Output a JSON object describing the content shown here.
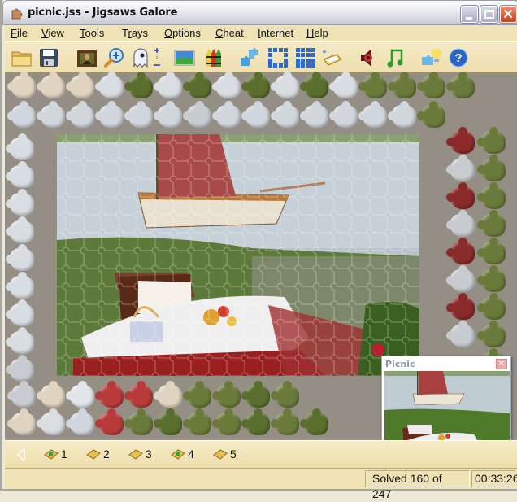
{
  "window": {
    "title": "picnic.jss - Jigsaws Galore",
    "controls": [
      "minimize",
      "maximize",
      "close"
    ]
  },
  "menu": [
    {
      "label": "File",
      "accel": "F"
    },
    {
      "label": "View",
      "accel": "V"
    },
    {
      "label": "Tools",
      "accel": "T"
    },
    {
      "label": "Trays",
      "accel": "r"
    },
    {
      "label": "Options",
      "accel": "O"
    },
    {
      "label": "Cheat",
      "accel": "C"
    },
    {
      "label": "Internet",
      "accel": "I"
    },
    {
      "label": "Help",
      "accel": "H"
    }
  ],
  "toolbar": [
    {
      "name": "open",
      "icon": "folder-icon"
    },
    {
      "name": "save",
      "icon": "floppy-disk-icon"
    },
    {
      "name": "picture",
      "icon": "mona-lisa-icon"
    },
    {
      "name": "zoom",
      "icon": "magnifier-icon"
    },
    {
      "name": "ghost",
      "icon": "ghost-icon"
    },
    {
      "name": "ghost-adjust",
      "icon": "plus-minus-icon"
    },
    {
      "name": "background",
      "icon": "landscape-icon"
    },
    {
      "name": "colors",
      "icon": "crayons-icon"
    },
    {
      "name": "scatter",
      "icon": "puzzle-pieces-icon"
    },
    {
      "name": "edge-pieces",
      "icon": "border-grid-icon"
    },
    {
      "name": "all-pieces",
      "icon": "full-grid-icon"
    },
    {
      "name": "new-tray",
      "icon": "tray-icon"
    },
    {
      "name": "sound",
      "icon": "speaker-icon"
    },
    {
      "name": "music",
      "icon": "music-note-icon"
    },
    {
      "name": "hint",
      "icon": "puzzle-lightbulb-icon"
    },
    {
      "name": "help",
      "icon": "help-icon"
    }
  ],
  "preview": {
    "title": "Picnic"
  },
  "trays": [
    {
      "label": "1",
      "has_pieces": true
    },
    {
      "label": "2",
      "has_pieces": false
    },
    {
      "label": "3",
      "has_pieces": false
    },
    {
      "label": "4",
      "has_pieces": true
    },
    {
      "label": "5",
      "has_pieces": false
    }
  ],
  "status": {
    "solved": "Solved 160 of 247",
    "time": "00:33:26"
  },
  "colors": {
    "board": "#958e84",
    "menubar": "#efe2b5",
    "toolbar": "#eedfae"
  }
}
